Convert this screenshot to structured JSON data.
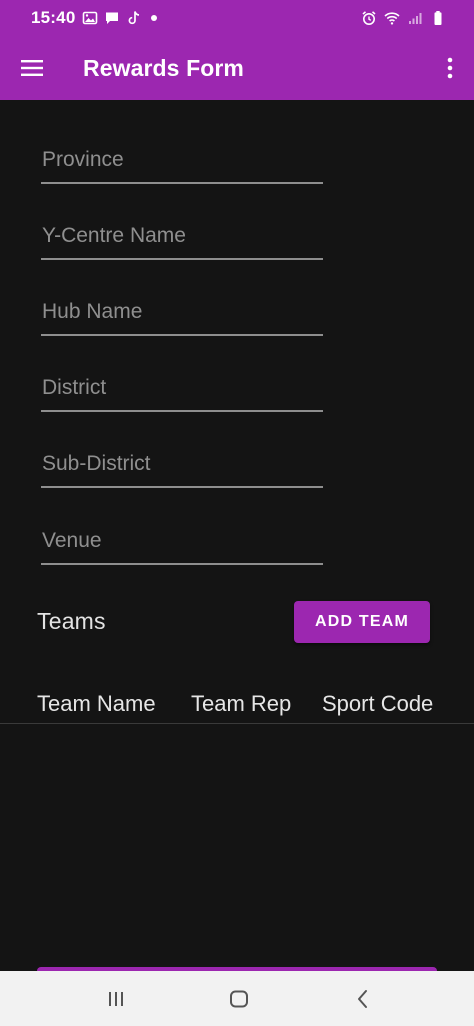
{
  "status_bar": {
    "time": "15:40",
    "left_icons": [
      "image-icon",
      "message-icon",
      "tiktok-icon",
      "notification-dot-icon"
    ],
    "right_icons": [
      "alarm-icon",
      "wifi-icon",
      "signal-icon",
      "battery-icon"
    ]
  },
  "app_bar": {
    "title": "Rewards Form",
    "menu_icon": "menu-icon",
    "overflow_icon": "more-vert-icon"
  },
  "form": {
    "fields": [
      {
        "placeholder": "Province",
        "value": ""
      },
      {
        "placeholder": "Y-Centre Name",
        "value": ""
      },
      {
        "placeholder": "Hub Name",
        "value": ""
      },
      {
        "placeholder": "District",
        "value": ""
      },
      {
        "placeholder": "Sub-District",
        "value": ""
      },
      {
        "placeholder": "Venue",
        "value": ""
      }
    ]
  },
  "teams": {
    "title": "Teams",
    "add_button_label": "ADD TEAM",
    "columns": [
      "Team Name",
      "Team Rep",
      "Sport Code"
    ],
    "rows": []
  },
  "nav_bar": {
    "buttons": [
      "recents-icon",
      "home-icon",
      "back-icon"
    ]
  },
  "colors": {
    "accent": "#9c27b0",
    "background": "#141414",
    "text": "#e6e6e6",
    "placeholder": "#8f8f8f",
    "underline": "#8e8e8e",
    "nav_background": "#f2f2f2"
  }
}
